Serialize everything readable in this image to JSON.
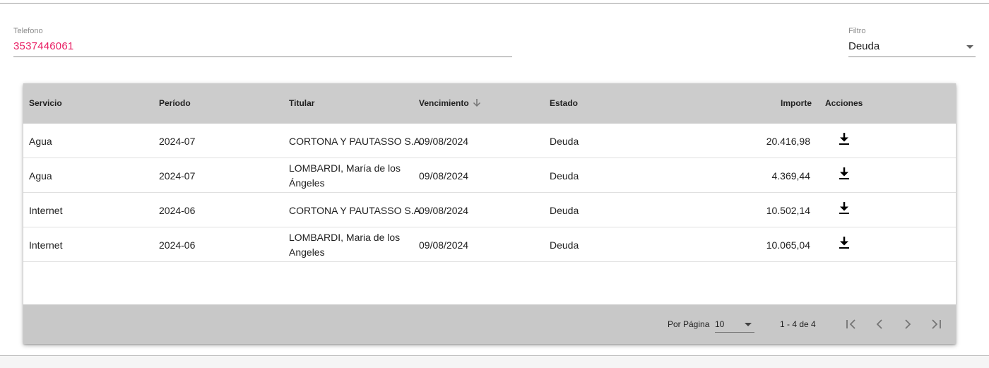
{
  "search": {
    "phone_label": "Telefono",
    "phone_value": "3537446061",
    "filter_label": "Filtro",
    "filter_value": "Deuda"
  },
  "table": {
    "headers": {
      "servicio": "Servicio",
      "periodo": "Período",
      "titular": "Titular",
      "vencimiento": "Vencimiento",
      "estado": "Estado",
      "importe": "Importe",
      "acciones": "Acciones"
    },
    "rows": [
      {
        "servicio": "Agua",
        "periodo": "2024-07",
        "titular": "CORTONA Y PAUTASSO S.A.",
        "vencimiento": "09/08/2024",
        "estado": "Deuda",
        "importe": "20.416,98",
        "action_icon": "download-icon"
      },
      {
        "servicio": "Agua",
        "periodo": "2024-07",
        "titular": "LOMBARDI, María de los Ángeles",
        "vencimiento": "09/08/2024",
        "estado": "Deuda",
        "importe": "4.369,44",
        "action_icon": "download-icon"
      },
      {
        "servicio": "Internet",
        "periodo": "2024-06",
        "titular": "CORTONA Y PAUTASSO S.A.",
        "vencimiento": "09/08/2024",
        "estado": "Deuda",
        "importe": "10.502,14",
        "action_icon": "download-icon"
      },
      {
        "servicio": "Internet",
        "periodo": "2024-06",
        "titular": "LOMBARDI, Maria de los Angeles",
        "vencimiento": "09/08/2024",
        "estado": "Deuda",
        "importe": "10.065,04",
        "action_icon": "download-icon"
      }
    ]
  },
  "pagination": {
    "per_page_label": "Por Página",
    "per_page_value": "10",
    "range_label": "1 - 4 de 4"
  },
  "colors": {
    "accent": "#e91e63",
    "header_bg": "#cccccc",
    "footer_bg": "#c8c8c8"
  }
}
